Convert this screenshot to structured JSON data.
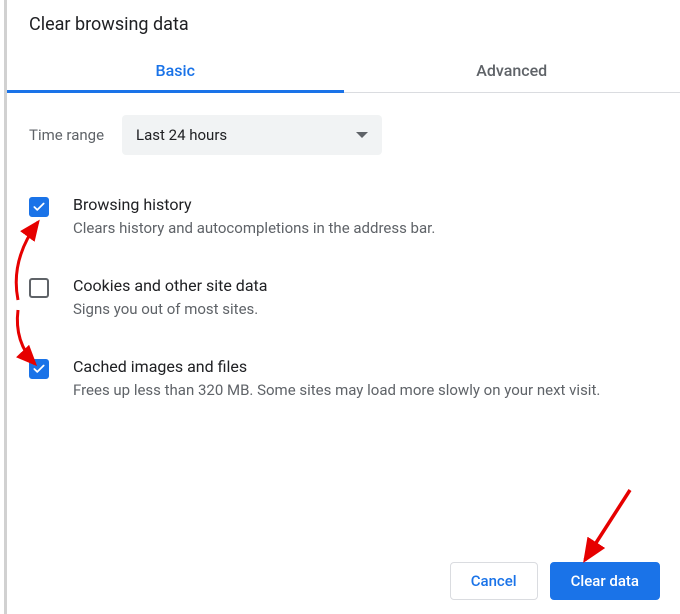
{
  "dialog": {
    "title": "Clear browsing data",
    "tabs": {
      "basic": "Basic",
      "advanced": "Advanced",
      "active": "basic"
    },
    "timerange": {
      "label": "Time range",
      "value": "Last 24 hours"
    },
    "options": [
      {
        "checked": true,
        "title": "Browsing history",
        "desc": "Clears history and autocompletions in the address bar."
      },
      {
        "checked": false,
        "title": "Cookies and other site data",
        "desc": "Signs you out of most sites."
      },
      {
        "checked": true,
        "title": "Cached images and files",
        "desc": "Frees up less than 320 MB. Some sites may load more slowly on your next visit."
      }
    ],
    "buttons": {
      "cancel": "Cancel",
      "confirm": "Clear data"
    }
  },
  "colors": {
    "accent": "#1a73e8",
    "text_muted": "#5f6368",
    "annotation": "#e60000"
  }
}
